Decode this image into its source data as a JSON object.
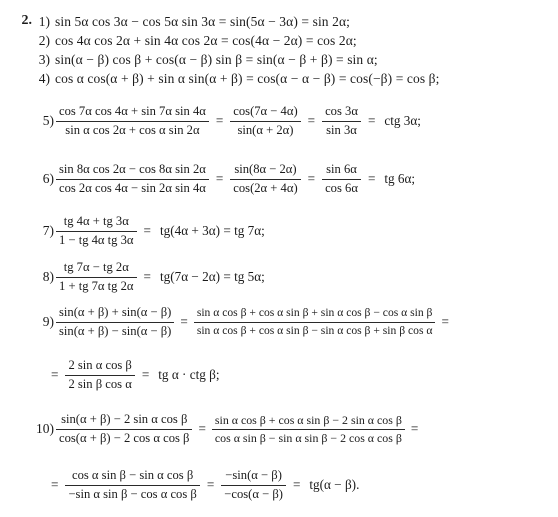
{
  "document": {
    "exercise_number": "2.",
    "background_color": "#ffffff",
    "text_color": "#1b1b1b"
  },
  "items": [
    {
      "label": "1)",
      "type": "plain",
      "text": "sin 5α cos 3α − cos 5α sin 3α = sin(5α − 3α) = sin 2α;"
    },
    {
      "label": "2)",
      "type": "plain",
      "text": "cos 4α cos 2α + sin 4α cos 2α = cos(4α − 2α) = cos 2α;"
    },
    {
      "label": "3)",
      "type": "plain",
      "text": "sin(α − β) cos β + cos(α − β) sin β = sin(α − β + β) = sin α;"
    },
    {
      "label": "4)",
      "type": "plain",
      "text": "cos α cos(α + β) + sin α sin(α + β) = cos(α − α − β) = cos(−β) = cos β;"
    },
    {
      "label": "5)",
      "type": "fraction",
      "fractions": [
        {
          "numerator": "cos 7α cos 4α + sin 7α sin 4α",
          "denominator": "sin α cos 2α + cos α sin 2α"
        },
        {
          "numerator": "cos(7α − 4α)",
          "denominator": "sin(α + 2α)"
        },
        {
          "numerator": "cos 3α",
          "denominator": "sin 3α"
        }
      ],
      "operators": [
        "=",
        "=",
        "="
      ],
      "tail": "ctg 3α;"
    },
    {
      "label": "6)",
      "type": "fraction",
      "fractions": [
        {
          "numerator": "sin 8α cos 2α − cos 8α sin 2α",
          "denominator": "cos 2α cos 4α − sin 2α sin 4α"
        },
        {
          "numerator": "sin(8α − 2α)",
          "denominator": "cos(2α + 4α)"
        },
        {
          "numerator": "sin 6α",
          "denominator": "cos 6α"
        }
      ],
      "operators": [
        "=",
        "=",
        "="
      ],
      "tail": "tg 6α;"
    },
    {
      "label": "7)",
      "type": "fraction",
      "fractions": [
        {
          "numerator": "tg 4α + tg 3α",
          "denominator": "1 − tg 4α tg 3α"
        }
      ],
      "operators": [
        "="
      ],
      "tail": "tg(4α + 3α) = tg 7α;"
    },
    {
      "label": "8)",
      "type": "fraction",
      "fractions": [
        {
          "numerator": "tg 7α − tg 2α",
          "denominator": "1 + tg 7α tg 2α"
        }
      ],
      "operators": [
        "="
      ],
      "tail": "tg(7α − 2α) = tg 5α;"
    },
    {
      "label": "9)",
      "type": "fraction",
      "fractions": [
        {
          "numerator": "sin(α + β) + sin(α − β)",
          "denominator": "sin(α + β) − sin(α − β)"
        },
        {
          "numerator": "sin α cos β + cos α sin β + sin α cos β − cos α sin β",
          "denominator": "sin α cos β + cos α sin β − sin α cos β + sin β cos α"
        }
      ],
      "operators": [
        "=",
        "=",
        "="
      ],
      "tail": ""
    },
    {
      "label": "",
      "type": "continuation",
      "lead": "=",
      "fractions": [
        {
          "numerator": "2 sin α cos β",
          "denominator": "2 sin β cos α"
        }
      ],
      "operators": [
        "="
      ],
      "tail": "tg α · ctg β;"
    },
    {
      "label": "10)",
      "type": "fraction",
      "fractions": [
        {
          "numerator": "sin(α + β) − 2 sin α cos β",
          "denominator": "cos(α + β) − 2 cos α cos β"
        },
        {
          "numerator": "sin α cos β + cos α sin β − 2 sin α cos β",
          "denominator": "cos α sin β − sin α sin β − 2 cos α cos β"
        }
      ],
      "operators": [
        "=",
        "=",
        "="
      ],
      "tail": ""
    },
    {
      "label": "",
      "type": "continuation",
      "lead": "=",
      "fractions": [
        {
          "numerator": "cos α sin β − sin α cos β",
          "denominator": "−sin α sin β − cos α cos β"
        },
        {
          "numerator": "−sin(α − β)",
          "denominator": "−cos(α − β)"
        }
      ],
      "operators": [
        "=",
        "="
      ],
      "tail": "tg(α − β)."
    }
  ]
}
